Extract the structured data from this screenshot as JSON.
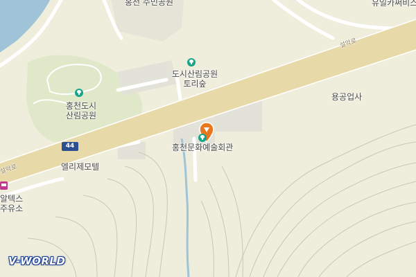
{
  "map": {
    "labels": {
      "top_partial": "홍천 주민공원",
      "top_right_partial": "유일카써비스",
      "park_top_line1": "도시산림공원",
      "park_top_line2": "토리숲",
      "park_left_line1": "홍천도시",
      "park_left_line2": "산림공원",
      "yonggong": "용공업사",
      "culture_center": "홍천문화예술회관",
      "motel": "엘리제모텔",
      "gas_line1": "알텍스",
      "gas_line2": "주유소",
      "road_seorak_right": "설악로",
      "road_seorak_left": "설악로"
    },
    "route_number": "44",
    "logo": "V-WORLD"
  },
  "colors": {
    "background": "#efeedd",
    "road_main": "#e8d9a8",
    "road_minor": "#ffffff",
    "water": "#9fc3d7",
    "park": "#dfe8c8",
    "building": "#e3e2d8",
    "contour": "#c9c6b2",
    "pin": "#e8781e",
    "park_icon": "#17a589"
  },
  "icons": [
    "park-icon",
    "location-pin-icon",
    "route-shield-icon",
    "bus-icon",
    "logo"
  ]
}
